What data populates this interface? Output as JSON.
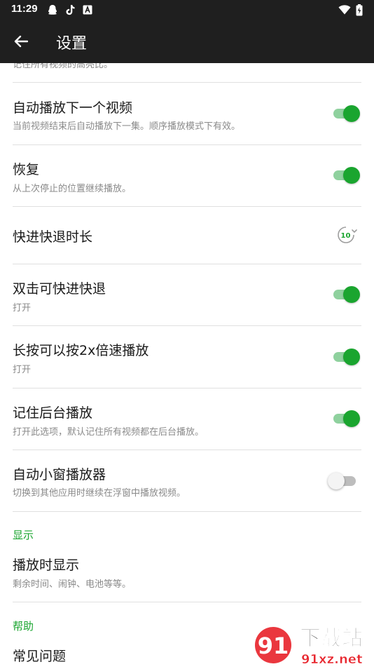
{
  "status_bar": {
    "time": "11:29",
    "icons": [
      "qq-icon",
      "tiktok-icon",
      "a-icon",
      "wifi-icon",
      "battery-icon"
    ]
  },
  "app_bar": {
    "back_icon": "arrow-left-icon",
    "title": "设置"
  },
  "settings": {
    "partial_top_sub": "记住所有视频的高亮比。",
    "autoplay_next": {
      "label": "自动播放下一个视频",
      "sub": "当前视频结束后自动播放下一集。顺序播放模式下有效。",
      "on": true
    },
    "resume": {
      "label": "恢复",
      "sub": "从上次停止的位置继续播放。",
      "on": true
    },
    "seek_duration": {
      "label": "快进快退时长",
      "value": "10"
    },
    "double_tap_seek": {
      "label": "双击可快进快退",
      "sub": "打开",
      "on": true
    },
    "long_press_2x": {
      "label": "长按可以按2x倍速播放",
      "sub": "打开",
      "on": true
    },
    "background_play": {
      "label": "记住后台播放",
      "sub": "打开此选项，默认记住所有视频都在后台播放。",
      "on": true
    },
    "auto_pip": {
      "label": "自动小窗播放器",
      "sub": "切换到其他应用时继续在浮窗中播放视频。",
      "on": false
    }
  },
  "display_section": {
    "header": "显示",
    "show_while_playing": {
      "label": "播放时显示",
      "sub": "剩余时间、闹钟、电池等等。"
    }
  },
  "help_section": {
    "header": "帮助",
    "faq": {
      "label": "常见问题"
    }
  },
  "watermark": {
    "logo_text": "91",
    "text": "下载站",
    "domain": "91xz.net"
  },
  "colors": {
    "accent": "#1aa52f",
    "bar": "#1f1f1f",
    "divider": "#e0e0e0"
  }
}
